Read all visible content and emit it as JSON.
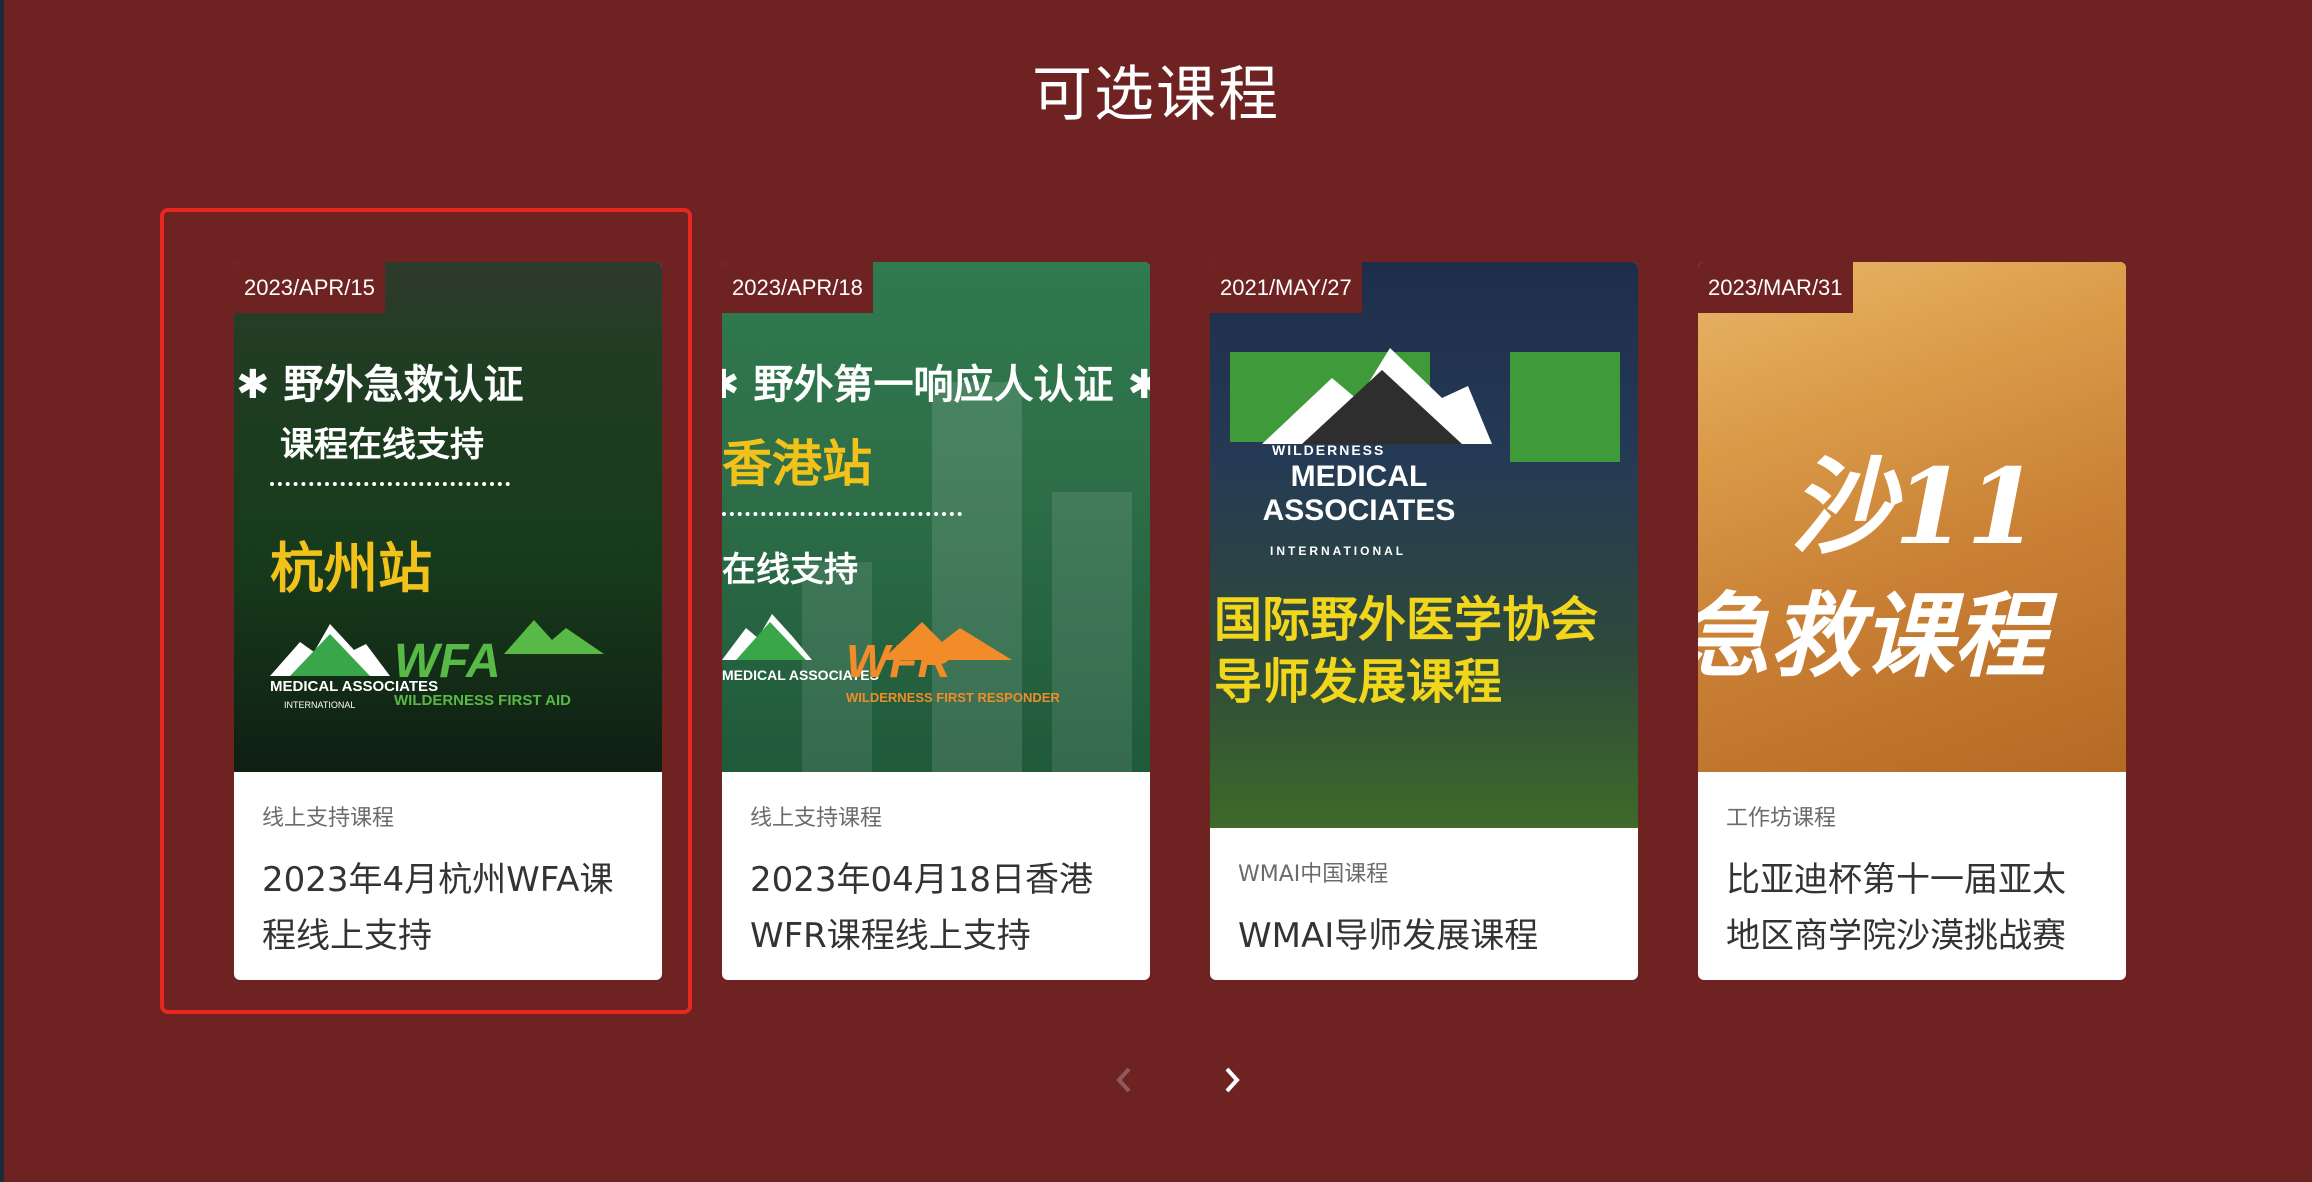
{
  "section": {
    "title": "可选课程"
  },
  "courses": [
    {
      "date": "2023/APR/15",
      "category": "线上支持课程",
      "title": "2023年4月杭州WFA课程线上支持",
      "image_lines": [
        "✱ 野外急救认证",
        "课程在线支持",
        "杭州站"
      ],
      "logo_text": "MEDICAL ASSOCIATES",
      "logo_sub": "INTERNATIONAL",
      "badge_text": "WFA",
      "badge_sub": "WILDERNESS FIRST AID"
    },
    {
      "date": "2023/APR/18",
      "category": "线上支持课程",
      "title": "2023年04月18日香港WFR课程线上支持",
      "image_lines": [
        "✱ 野外第一响应人认证 ✱",
        "香港站",
        "在线支持"
      ],
      "logo_text": "MEDICAL ASSOCIATES",
      "badge_text": "WFR",
      "badge_sub": "WILDERNESS FIRST RESPONDER"
    },
    {
      "date": "2021/MAY/27",
      "category": "WMAI中国课程",
      "title": "WMAI导师发展课程",
      "image_lines": [
        "国际野外医学协会",
        "导师发展课程"
      ],
      "logo_text": "MEDICAL ASSOCIATES",
      "logo_sub": "INTERNATIONAL",
      "logo_top": "WILDERNESS"
    },
    {
      "date": "2023/MAR/31",
      "category": "工作坊课程",
      "title": "比亚迪杯第十一届亚太地区商学院沙漠挑战赛",
      "image_lines": [
        "沙11",
        "急救课程"
      ]
    }
  ],
  "nav": {
    "prev_icon": "chevron-left-icon",
    "next_icon": "chevron-right-icon"
  },
  "colors": {
    "background": "#6e2322",
    "highlight": "#e8281f",
    "accent_yellow": "#f2c21b"
  }
}
